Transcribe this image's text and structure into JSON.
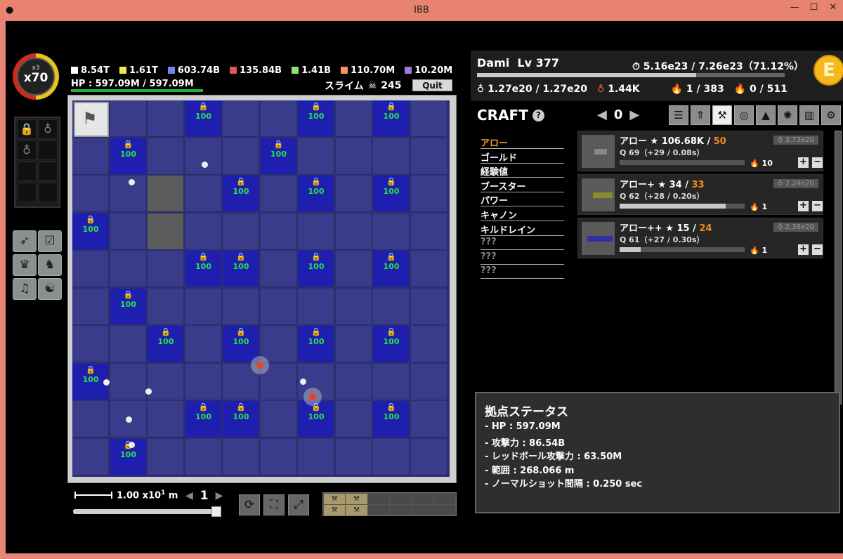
{
  "window": {
    "title": "IBB",
    "min": "—",
    "max": "☐",
    "close": "✕"
  },
  "multiplier": {
    "small": "x3",
    "value": "x70"
  },
  "resources": [
    {
      "color": "#ffffff",
      "value": "8.54T"
    },
    {
      "color": "#f2ea4a",
      "value": "1.61T"
    },
    {
      "color": "#6f86e8",
      "value": "603.74B"
    },
    {
      "color": "#e85454",
      "value": "135.84B"
    },
    {
      "color": "#8ee07a",
      "value": "1.41B"
    },
    {
      "color": "#f2936a",
      "value": "110.70M"
    },
    {
      "color": "#a07ae0",
      "value": "10.20M"
    }
  ],
  "hp": {
    "text": "HP : 597.09M / 597.09M",
    "ratio": 1.0
  },
  "enemy": {
    "name": "スライム",
    "count": "245"
  },
  "quit_label": "Quit",
  "map": {
    "level_label": "100",
    "scale_text": "1.00 x10",
    "scale_exp": "1",
    "scale_unit": "m",
    "page": "1",
    "slider_value": 1.0
  },
  "player": {
    "name": "Dami",
    "level": "Lv 377",
    "exp": "5.16e23 / 7.26e23（71.12%）",
    "exp_ratio": 0.7112,
    "gold_bag": "1.27e20 / 1.27e20",
    "red_bag": "1.44K",
    "fire_white": "1 / 383",
    "fire_red": "0 / 511",
    "coin": "E"
  },
  "craft": {
    "title": "CRAFT",
    "help": "?",
    "count": "0",
    "categories": [
      {
        "label": "アロー",
        "state": "selected"
      },
      {
        "label": "ゴールド",
        "state": ""
      },
      {
        "label": "経験値",
        "state": ""
      },
      {
        "label": "ブースター",
        "state": ""
      },
      {
        "label": "パワー",
        "state": ""
      },
      {
        "label": "キャノン",
        "state": ""
      },
      {
        "label": "キルドレイン",
        "state": ""
      },
      {
        "label": "???",
        "state": "unknown"
      },
      {
        "label": "???",
        "state": "unknown"
      },
      {
        "label": "???",
        "state": "unknown"
      }
    ],
    "items": [
      {
        "name": "アロー ★ 106.68K / ",
        "max": "50",
        "q": "Q 69（+29 / 0.08s）",
        "progress": 0.0,
        "cost": "3.73e20",
        "fire": "10"
      },
      {
        "name": "アロー+ ★ 34 / ",
        "max": "33",
        "q": "Q 62（+28 / 0.20s）",
        "progress": 0.85,
        "cost": "2.24e20",
        "fire": "1"
      },
      {
        "name": "アロー++ ★ 15 / ",
        "max": "24",
        "q": "Q 61（+27 / 0.30s）",
        "progress": 0.17,
        "cost": "2.38e20",
        "fire": "1"
      }
    ]
  },
  "base_status": {
    "title": "拠点ステータス",
    "lines": [
      "- HP : 597.09M",
      "- 攻撃力 : 86.54B",
      "- レッドボール攻撃力 : 63.50M",
      "- 範囲 : 268.066 m",
      "- ノーマルショット間隔 : 0.250 sec"
    ]
  },
  "quick_slots": [
    "⚒",
    "⚒",
    "",
    "",
    "",
    "",
    "⚒",
    "⚒",
    "",
    "",
    "",
    ""
  ]
}
